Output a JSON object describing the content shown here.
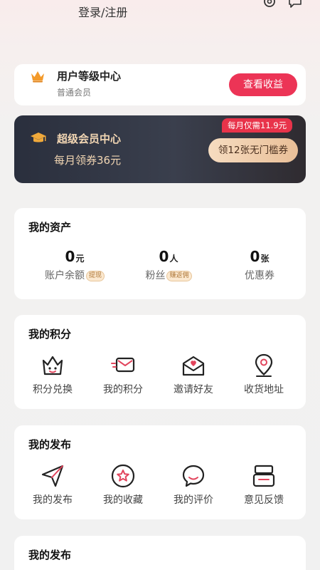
{
  "header": {
    "login_label": "登录/注册",
    "icons": [
      "settings-icon",
      "message-icon"
    ]
  },
  "level_card": {
    "icon": "crown-icon",
    "title": "用户等级中心",
    "subtitle": "普通会员",
    "button_label": "查看收益",
    "accent": "#ec3456"
  },
  "vip_card": {
    "icon": "graduation-cap-icon",
    "title": "超级会员中心",
    "subtitle": "每月领券36元",
    "price_tag": "每月仅需11.9元",
    "button_label": "领12张无门槛券",
    "accent": "#f2d6b3"
  },
  "assets": {
    "title": "我的资产",
    "items": [
      {
        "value": "0",
        "unit": "元",
        "label": "账户余额",
        "badge": "提现"
      },
      {
        "value": "0",
        "unit": "人",
        "label": "粉丝",
        "badge": "赚返佣"
      },
      {
        "value": "0",
        "unit": "张",
        "label": "优惠券",
        "badge": ""
      }
    ]
  },
  "points": {
    "title": "我的积分",
    "items": [
      {
        "label": "积分兑换",
        "icon": "crown-face-icon"
      },
      {
        "label": "我的积分",
        "icon": "envelope-fast-icon"
      },
      {
        "label": "邀请好友",
        "icon": "heart-letter-icon"
      },
      {
        "label": "收货地址",
        "icon": "location-pin-icon"
      }
    ]
  },
  "publish": {
    "title": "我的发布",
    "items": [
      {
        "label": "我的发布",
        "icon": "paper-plane-icon"
      },
      {
        "label": "我的收藏",
        "icon": "star-circle-icon"
      },
      {
        "label": "我的评价",
        "icon": "chat-bubble-icon"
      },
      {
        "label": "意见反馈",
        "icon": "feedback-box-icon"
      }
    ]
  },
  "publish2": {
    "title": "我的发布"
  }
}
